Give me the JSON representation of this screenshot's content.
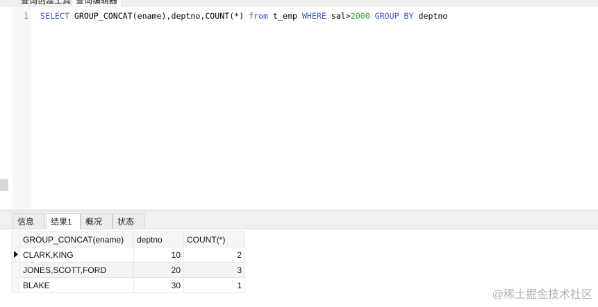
{
  "top_tabs": [
    "查询创建工具",
    "查询编辑器"
  ],
  "editor": {
    "line_number": "1",
    "tokens": [
      {
        "text": "SELECT",
        "kind": "kw"
      },
      {
        "text": " GROUP_CONCAT(ename),deptno,COUNT(*) ",
        "kind": "plain"
      },
      {
        "text": "from",
        "kind": "kw"
      },
      {
        "text": " t_emp ",
        "kind": "plain"
      },
      {
        "text": "WHERE",
        "kind": "kw"
      },
      {
        "text": " sal>",
        "kind": "plain"
      },
      {
        "text": "2000",
        "kind": "num"
      },
      {
        "text": " ",
        "kind": "plain"
      },
      {
        "text": "GROUP BY",
        "kind": "kw"
      },
      {
        "text": " deptno",
        "kind": "plain"
      }
    ]
  },
  "result_tabs": [
    {
      "label": "信息",
      "active": false
    },
    {
      "label": "结果1",
      "active": true
    },
    {
      "label": "概况",
      "active": false
    },
    {
      "label": "状态",
      "active": false
    }
  ],
  "grid": {
    "columns": [
      "GROUP_CONCAT(ename)",
      "deptno",
      "COUNT(*)"
    ],
    "rows": [
      [
        "CLARK,KING",
        "10",
        "2"
      ],
      [
        "JONES,SCOTT,FORD",
        "20",
        "3"
      ],
      [
        "BLAKE",
        "30",
        "1"
      ]
    ]
  },
  "watermark": "@稀土掘金技术社区",
  "colors": {
    "keyword": "#3b4fc4",
    "number": "#2a9d2a"
  }
}
